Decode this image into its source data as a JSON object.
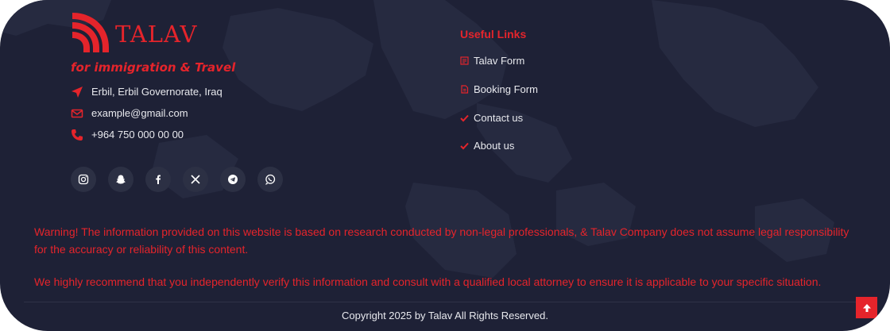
{
  "brand": {
    "name": "TALAV",
    "tagline": "for immigration & Travel"
  },
  "contact": {
    "address": "Erbil, Erbil Governorate, Iraq",
    "email": "example@gmail.com",
    "phone": "+964 750 000 00 00"
  },
  "social": [
    "instagram-icon",
    "snapchat-icon",
    "facebook-icon",
    "x-icon",
    "telegram-icon",
    "whatsapp-icon"
  ],
  "useful_links": {
    "title": "Useful Links",
    "items": [
      {
        "label": "Talav Form",
        "icon": "form-icon"
      },
      {
        "label": "Booking Form",
        "icon": "document-icon"
      },
      {
        "label": "Contact us",
        "icon": "check-icon"
      },
      {
        "label": "About us",
        "icon": "check-icon"
      }
    ]
  },
  "disclaimer": {
    "warning": "Warning! The information provided on this website is based on research conducted by non-legal professionals, & Talav Company does not assume legal responsibility for the accuracy or reliability of this content.",
    "recommendation": "We highly recommend that you independently verify this information and consult with a qualified local attorney to ensure it is applicable to your specific situation."
  },
  "copyright": "Copyright 2025 by Talav All Rights Reserved.",
  "colors": {
    "background": "#1e2136",
    "accent": "#e5242b",
    "text": "#e8e9ee"
  }
}
